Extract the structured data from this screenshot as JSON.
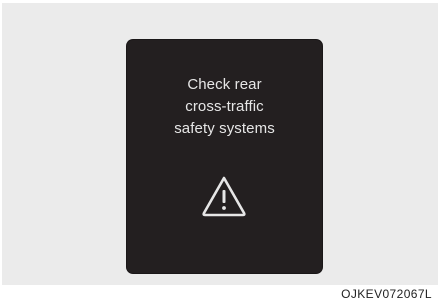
{
  "display": {
    "message_lines": [
      "Check rear",
      "cross-traffic",
      "safety systems"
    ],
    "icon": "warning-triangle-icon"
  },
  "figure_code": "OJKEV072067L",
  "colors": {
    "panel_background": "#ebebeb",
    "display_background": "#231f20",
    "text": "#e6e6e6"
  }
}
